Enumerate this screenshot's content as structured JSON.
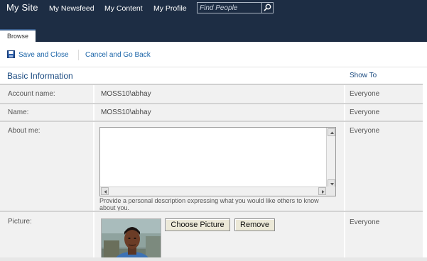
{
  "header": {
    "site_title": "My Site",
    "nav": [
      "My Newsfeed",
      "My Content",
      "My Profile"
    ],
    "search_placeholder": "Find People",
    "active_tab": "Browse"
  },
  "ribbon": {
    "save_label": "Save and Close",
    "cancel_label": "Cancel and Go Back"
  },
  "form": {
    "section_title": "Basic Information",
    "show_to_header": "Show To",
    "account_name": {
      "label": "Account name:",
      "value": "MOSS10\\abhay",
      "show_to": "Everyone"
    },
    "name": {
      "label": "Name:",
      "value": "MOSS10\\abhay",
      "show_to": "Everyone"
    },
    "about_me": {
      "label": "About me:",
      "value": "",
      "hint": "Provide a personal description expressing what you would like others to know about you.",
      "show_to": "Everyone"
    },
    "picture": {
      "label": "Picture:",
      "choose_label": "Choose Picture",
      "remove_label": "Remove",
      "show_to": "Everyone"
    }
  }
}
